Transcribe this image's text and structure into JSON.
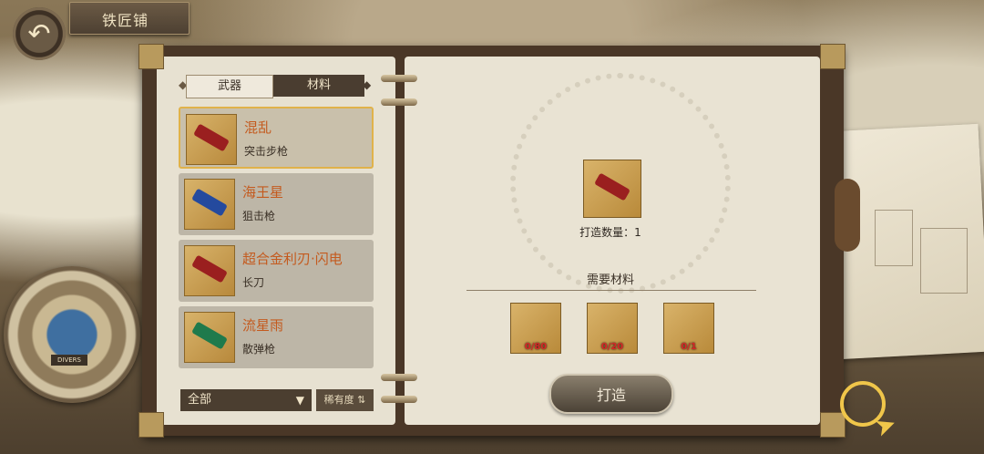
{
  "header": {
    "title": "铁匠铺",
    "back_icon": "back-arrow-icon"
  },
  "tabs": [
    {
      "label": "武器",
      "active": true
    },
    {
      "label": "材料",
      "active": false
    }
  ],
  "weapon_list": [
    {
      "name": "混乱",
      "type": "突击步枪",
      "selected": true
    },
    {
      "name": "海王星",
      "type": "狙击枪",
      "selected": false
    },
    {
      "name": "超合金利刃·闪电",
      "type": "长刀",
      "selected": false
    },
    {
      "name": "流星雨",
      "type": "散弹枪",
      "selected": false
    }
  ],
  "filter": {
    "value": "全部"
  },
  "sort": {
    "label": "稀有度"
  },
  "craft": {
    "quantity_text": "打造数量：1",
    "materials_title": "需要材料",
    "materials": [
      {
        "count": "0/80"
      },
      {
        "count": "0/20"
      },
      {
        "count": "0/1"
      }
    ],
    "button_label": "打造"
  },
  "badge": {
    "label": "DIVERS"
  },
  "colors": {
    "selected_border": "#e0b24a",
    "name_orange": "#c45a1e",
    "count_red": "#d62828"
  }
}
